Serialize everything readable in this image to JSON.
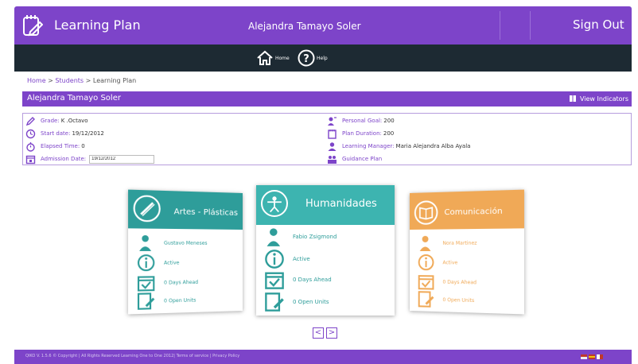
{
  "header": {
    "app_title": "Learning Plan",
    "user_name": "Alejandra Tamayo Soler",
    "sign_out": "Sign Out"
  },
  "nav": {
    "home": "Home",
    "help": "Help"
  },
  "breadcrumb": {
    "home": "Home",
    "students": "Students",
    "current": "Learning Plan",
    "sep": " > "
  },
  "student_bar": {
    "name": "Alejandra Tamayo Soler",
    "view_indicators": "View Indicators"
  },
  "info": {
    "grade_label": "Grade:",
    "grade_value": "K .Octavo",
    "start_label": "Start date:",
    "start_value": "19/12/2012",
    "elapsed_label": "Elapsed Time:",
    "elapsed_value": "0",
    "admission_label": "Admission Date:",
    "admission_value": "19/12/2012",
    "goal_label": "Personal Goal:",
    "goal_value": "200",
    "duration_label": "Plan Duration:",
    "duration_value": "200",
    "manager_label": "Learning Manager:",
    "manager_value": "Maria Alejandra Alba Ayala",
    "guidance_plan": "Guidance Plan"
  },
  "cards": [
    {
      "title": "Artes - Plásticas",
      "person": "Gustavo Meneses",
      "status": "Active",
      "days": "0 Days Ahead",
      "units": "0 Open Units",
      "color": "#2e9d9a"
    },
    {
      "title": "Humanidades",
      "person": "Fabio Zsigmond",
      "status": "Active",
      "days": "0 Days Ahead",
      "units": "0 Open Units",
      "color": "#3db4b0"
    },
    {
      "title": "Comunicación",
      "person": "Nora Martinez",
      "status": "Active",
      "days": "0 Days Ahead",
      "units": "0 Open Units",
      "color": "#f0a957"
    }
  ],
  "pager": {
    "prev": "<",
    "next": ">"
  },
  "footer": {
    "copyright": "QIKO V. 1.5.6 © Copyright | All Rights Reserved Learning One to One 2012|",
    "terms": "Terms of service",
    "sep": " | ",
    "privacy": "Privacy Policy"
  },
  "colors": {
    "primary": "#7d44c9",
    "dark": "#1d2a33",
    "teal": "#3db4b0",
    "orange": "#f0a957"
  }
}
